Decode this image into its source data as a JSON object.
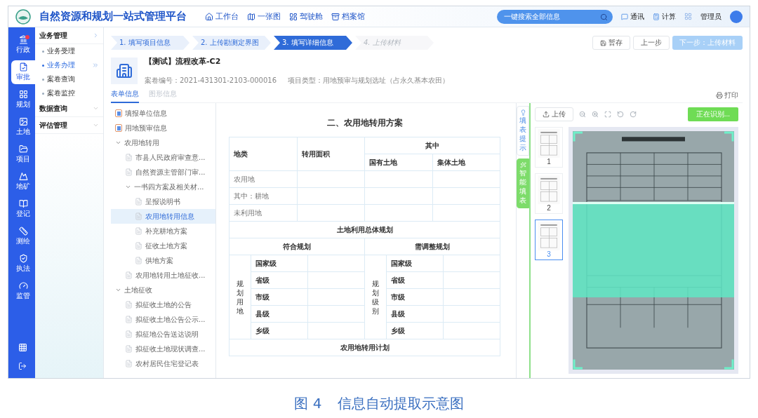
{
  "header": {
    "title": "自然资源和规划一站式管理平台",
    "nav": [
      {
        "label": "工作台"
      },
      {
        "label": "一张图"
      },
      {
        "label": "驾驶舱"
      },
      {
        "label": "档案馆"
      }
    ],
    "search": {
      "placeholder": "一键搜索全部信息"
    },
    "tools": [
      {
        "label": "通讯"
      },
      {
        "label": "计算"
      }
    ],
    "user": "管理员"
  },
  "rail": [
    {
      "label": "行政",
      "selected": false,
      "alert": true
    },
    {
      "label": "审批",
      "selected": true,
      "alert": false
    },
    {
      "label": "规划",
      "selected": false,
      "alert": false
    },
    {
      "label": "土地",
      "selected": false,
      "alert": false
    },
    {
      "label": "项目",
      "selected": false,
      "alert": false
    },
    {
      "label": "地矿",
      "selected": false,
      "alert": false
    },
    {
      "label": "登记",
      "selected": false,
      "alert": false
    },
    {
      "label": "测绘",
      "selected": false,
      "alert": false
    },
    {
      "label": "执法",
      "selected": false,
      "alert": false
    },
    {
      "label": "监管",
      "selected": false,
      "alert": false
    }
  ],
  "submenu": [
    {
      "label": "业务管理",
      "expanded": true,
      "children": [
        {
          "label": "业务受理",
          "selected": false
        },
        {
          "label": "业务办理",
          "selected": true
        },
        {
          "label": "案卷查询",
          "selected": false
        },
        {
          "label": "案卷监控",
          "selected": false
        }
      ]
    },
    {
      "label": "数据查询",
      "expanded": false
    },
    {
      "label": "评估管理",
      "expanded": false
    }
  ],
  "steps": [
    {
      "label": "1.  填写项目信息",
      "selected": false,
      "disabled": false
    },
    {
      "label": "2.  上传勘测定界图",
      "selected": false,
      "disabled": false
    },
    {
      "label": "3.  填写详细信息",
      "selected": true,
      "disabled": false
    },
    {
      "label": "4.  上传材料",
      "selected": false,
      "disabled": true
    }
  ],
  "actions": [
    {
      "label": "暂存",
      "kind": "save",
      "disabled": false
    },
    {
      "label": "上一步",
      "kind": "plain",
      "disabled": false
    },
    {
      "label": "下一步：上传材料",
      "kind": "primary",
      "disabled": true
    }
  ],
  "project": {
    "title": "【测试】流程改革-C2",
    "case_no": "案卷编号：2021-431301-2103-000016",
    "type": "项目类型：用地预审与规划选址（占永久基本农田）"
  },
  "tabs": [
    {
      "label": "表单信息",
      "selected": true
    },
    {
      "label": "图形信息",
      "selected": false
    }
  ],
  "print": "打印",
  "tree": [
    {
      "label": "填报单位信息",
      "kind": "form",
      "selected": false
    },
    {
      "label": "用地预审信息",
      "kind": "form",
      "selected": false
    },
    {
      "label": "农用地转用",
      "kind": "folder",
      "selected": false,
      "expanded": true,
      "children": [
        {
          "label": "市县人民政府审查意...",
          "kind": "doc",
          "selected": false
        },
        {
          "label": "自然资源主管部门审...",
          "kind": "doc",
          "selected": false
        },
        {
          "label": "一书四方案及相关材...",
          "kind": "folder",
          "selected": false,
          "expanded": true,
          "children": [
            {
              "label": "呈报说明书",
              "kind": "doc",
              "selected": false
            },
            {
              "label": "农用地转用信息",
              "kind": "doc",
              "selected": true
            },
            {
              "label": "补充耕地方案",
              "kind": "doc",
              "selected": false
            },
            {
              "label": "征收土地方案",
              "kind": "doc",
              "selected": false
            },
            {
              "label": "供地方案",
              "kind": "doc",
              "selected": false
            }
          ]
        },
        {
          "label": "农用地转用土地征收...",
          "kind": "doc",
          "selected": false
        }
      ]
    },
    {
      "label": "土地征收",
      "kind": "folder",
      "selected": false,
      "expanded": true,
      "children": [
        {
          "label": "拟征收土地的公告",
          "kind": "doc",
          "selected": false
        },
        {
          "label": "拟征收土地公告公示...",
          "kind": "doc",
          "selected": false
        },
        {
          "label": "拟征地公告送达说明",
          "kind": "doc",
          "selected": false
        },
        {
          "label": "拟征收土地现状调查...",
          "kind": "doc",
          "selected": false
        },
        {
          "label": "农村居民住宅登记表",
          "kind": "doc",
          "selected": false
        }
      ]
    }
  ],
  "form": {
    "title": "二、农用地转用方案",
    "sections": [
      {
        "rows": [
          [
            {
              "text": "地类",
              "kind": "head",
              "rowspan": 2
            },
            {
              "text": "转用面积",
              "kind": "head",
              "rowspan": 2
            },
            {
              "text": "其中",
              "kind": "center",
              "colspan": 2
            }
          ],
          [
            {
              "text": "国有土地",
              "kind": "head"
            },
            {
              "text": "集体土地",
              "kind": "head"
            }
          ],
          [
            {
              "text": "农用地",
              "kind": "label"
            },
            {
              "kind": "blank"
            },
            {
              "kind": "blank"
            },
            {
              "kind": "blank"
            }
          ],
          [
            {
              "text": "其中：耕地",
              "kind": "label"
            },
            {
              "kind": "blank"
            },
            {
              "kind": "blank"
            },
            {
              "kind": "blank"
            }
          ],
          [
            {
              "text": "未利用地",
              "kind": "label"
            },
            {
              "kind": "blank"
            },
            {
              "kind": "blank"
            },
            {
              "kind": "blank"
            }
          ]
        ]
      },
      {
        "rows": [
          [
            {
              "text": "土地利用总体规划",
              "kind": "center"
            }
          ]
        ]
      },
      {
        "rows": [
          [
            {
              "text": "符合规划",
              "kind": "center",
              "colspan": 3
            },
            {
              "text": "需调整规划",
              "kind": "center",
              "colspan": 3
            }
          ],
          [
            {
              "text": "规划用地",
              "kind": "vertical",
              "rowspan": 5
            },
            {
              "text": "国家级",
              "kind": "head"
            },
            {
              "kind": "blank"
            },
            {
              "text": "规划级别",
              "kind": "vertical",
              "rowspan": 5
            },
            {
              "text": "国家级",
              "kind": "head"
            },
            {
              "kind": "blank"
            }
          ],
          [
            {
              "text": "省级",
              "kind": "head"
            },
            {
              "kind": "blank"
            },
            {
              "text": "省级",
              "kind": "head"
            },
            {
              "kind": "blank"
            }
          ],
          [
            {
              "text": "市级",
              "kind": "head"
            },
            {
              "kind": "blank"
            },
            {
              "text": "市级",
              "kind": "head"
            },
            {
              "kind": "blank"
            }
          ],
          [
            {
              "text": "县级",
              "kind": "head"
            },
            {
              "kind": "blank"
            },
            {
              "text": "县级",
              "kind": "head"
            },
            {
              "kind": "blank"
            }
          ],
          [
            {
              "text": "乡级",
              "kind": "head"
            },
            {
              "kind": "blank"
            },
            {
              "text": "乡级",
              "kind": "head"
            },
            {
              "kind": "blank"
            }
          ]
        ]
      },
      {
        "rows": [
          [
            {
              "text": "农用地转用计划",
              "kind": "center"
            }
          ]
        ]
      }
    ]
  },
  "recognition": {
    "side_tabs": [
      {
        "label": "填表提示",
        "selected": false
      },
      {
        "label": "智能填表",
        "selected": true
      }
    ],
    "upload": "上传",
    "status_button": "正在识别...",
    "pages": [
      {
        "label": "1",
        "selected": false
      },
      {
        "label": "2",
        "selected": false
      },
      {
        "label": "3",
        "selected": true
      }
    ]
  },
  "caption": {
    "label": "图 4",
    "text": "信息自动提取示意图"
  }
}
